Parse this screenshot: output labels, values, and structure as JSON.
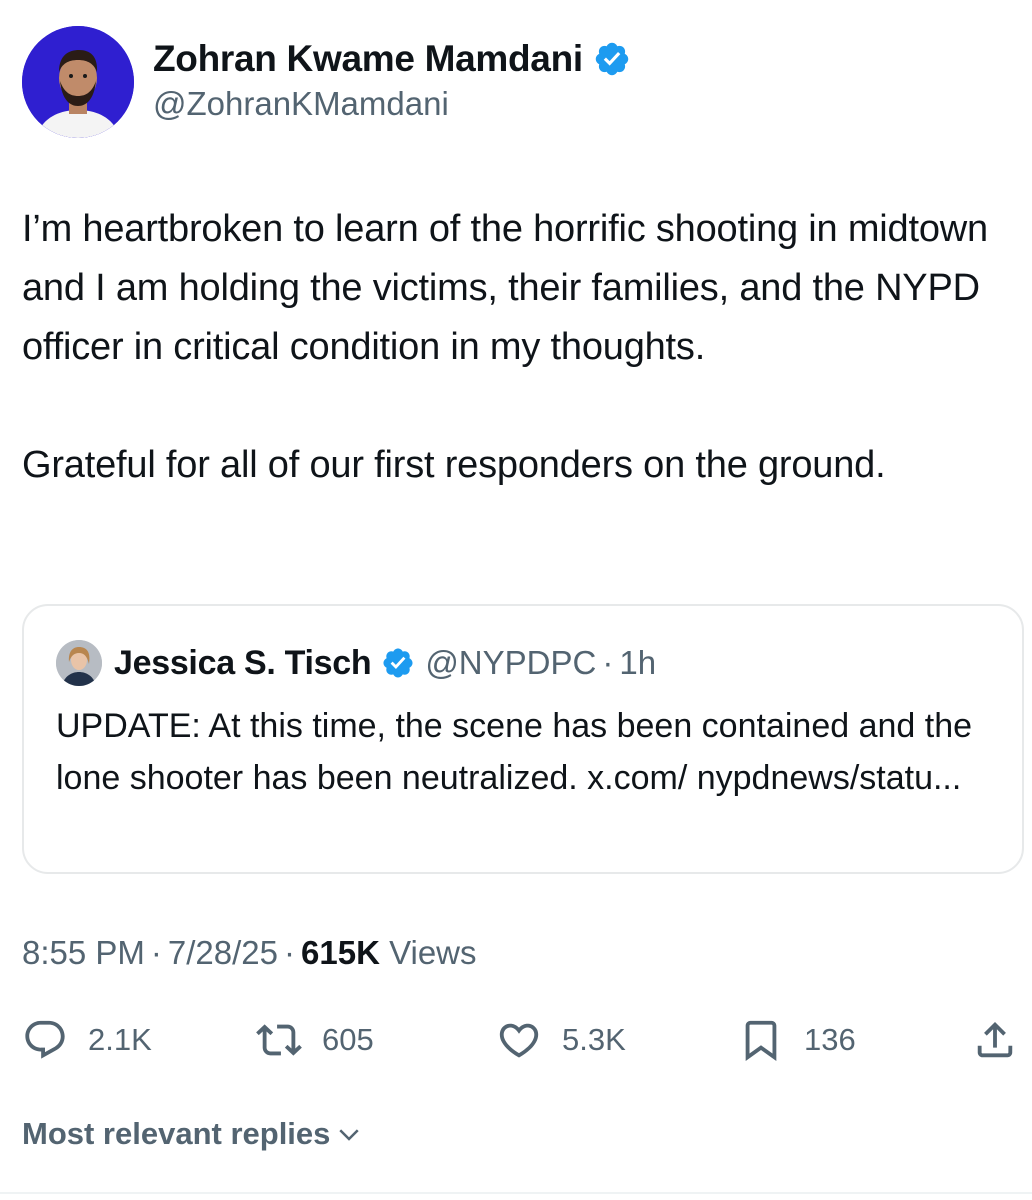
{
  "author": {
    "name": "Zohran Kwame Mamdani",
    "handle": "@ZohranKMamdani"
  },
  "tweet": {
    "paragraph1": "I’m heartbroken to learn of the horrific shooting in midtown and I am holding the victims, their families, and the NYPD officer in critical condition in my thoughts.",
    "paragraph2": "Grateful for all of our first responders on the ground."
  },
  "quote": {
    "name": "Jessica S. Tisch",
    "handle": "@NYPDPC",
    "separator": "·",
    "time": "1h",
    "text": "UPDATE: At this time, the scene has been contained and the lone shooter has been neutralized. x.com/ nypdnews/statu..."
  },
  "meta": {
    "time": "8:55 PM",
    "separator": "·",
    "date": "7/28/25",
    "views_count": "615K",
    "views_label": "Views"
  },
  "actions": {
    "replies": "2.1K",
    "reposts": "605",
    "likes": "5.3K",
    "bookmarks": "136"
  },
  "icons": {
    "reply": "reply-icon",
    "repost": "repost-icon",
    "like": "heart-icon",
    "bookmark": "bookmark-icon",
    "share": "share-icon",
    "verified": "verified-badge-icon",
    "chevron": "chevron-down-icon"
  },
  "replies_sort": {
    "label": "Most relevant replies"
  },
  "colors": {
    "text_primary": "#0f1419",
    "text_secondary": "#536471",
    "verified_blue": "#1d9bf0",
    "avatar_bg": "#2f1fd0",
    "border": "#e7e9ea"
  }
}
